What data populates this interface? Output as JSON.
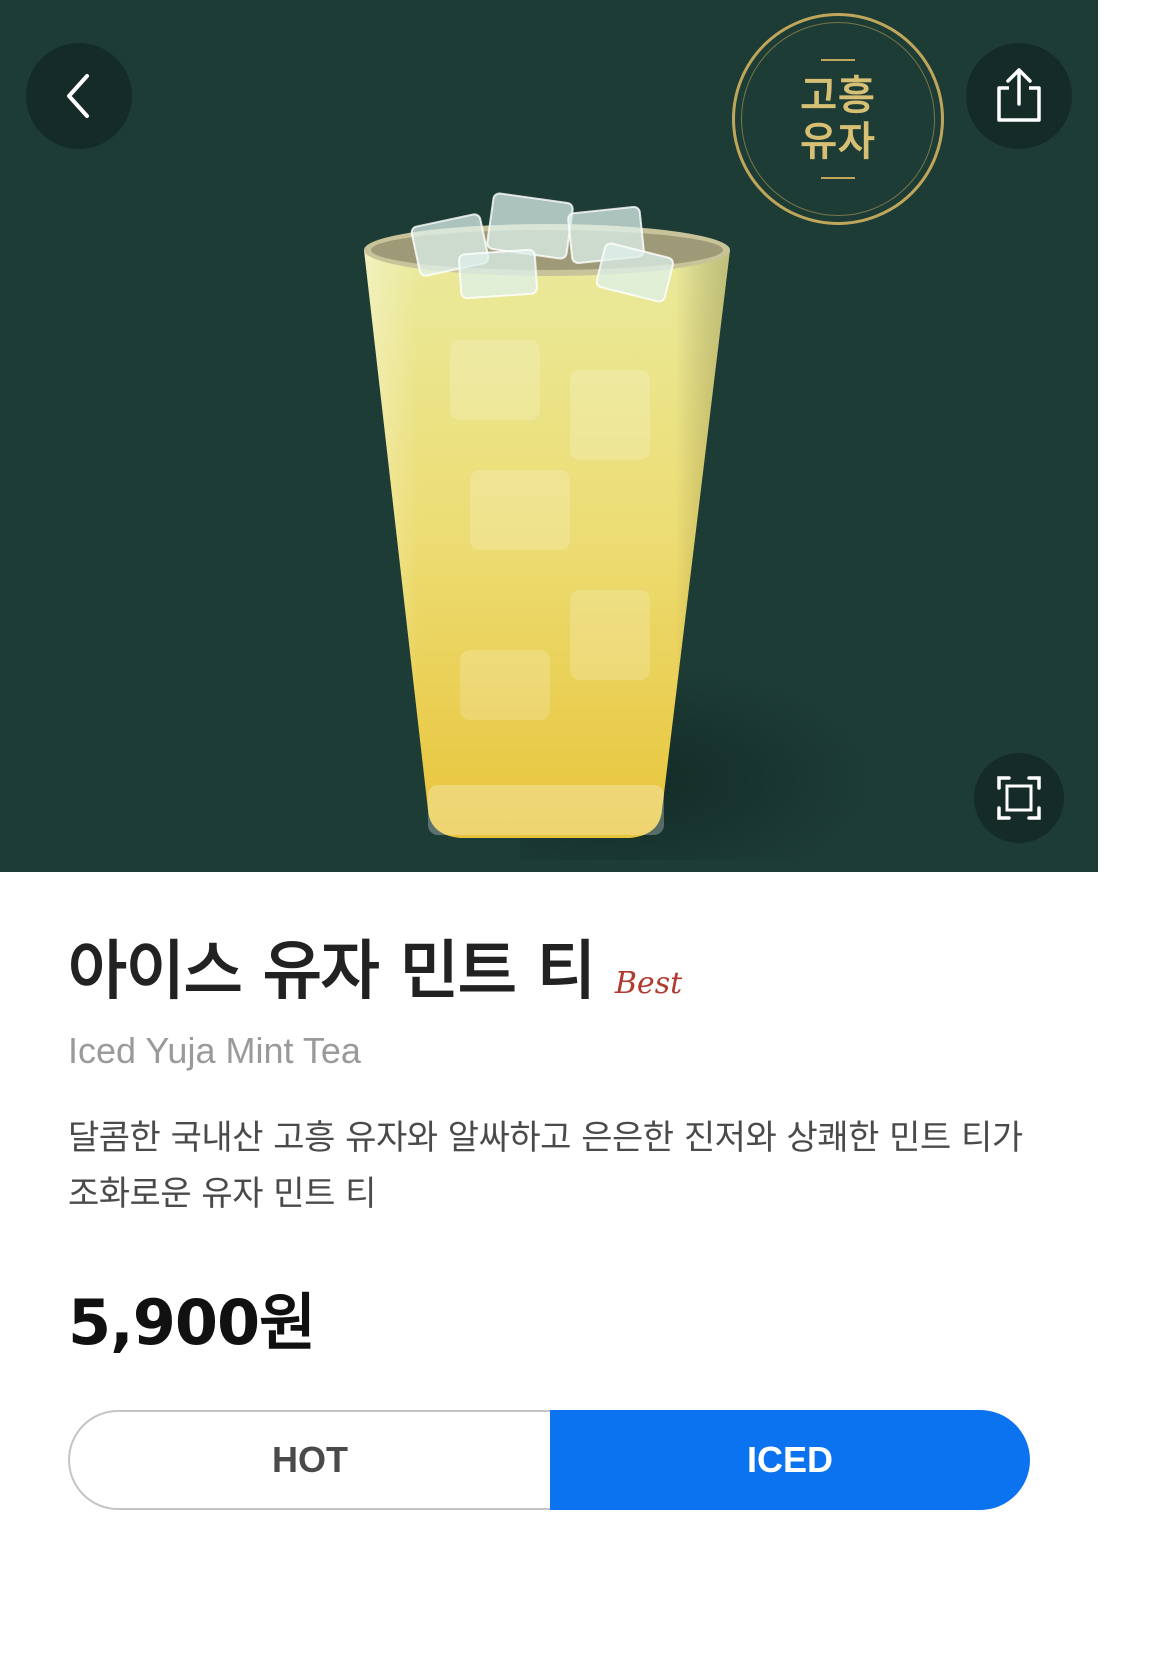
{
  "product": {
    "badge": "고흥\n유자",
    "badge_color": "#bfa65a",
    "title": "아이스 유자 민트 티",
    "best_label": "Best",
    "english_name": "Iced Yuja Mint Tea",
    "description": "달콤한 국내산 고흥 유자와 알싸하고 은은한 진저와 상쾌한 민트 티가 조화로운 유자 민트 티",
    "price": "5,900원"
  },
  "icons": {
    "back": "chevron-left-icon",
    "share": "share-icon",
    "zoom": "expand-icon"
  },
  "temperature": {
    "options": [
      "HOT",
      "ICED"
    ],
    "selected": "ICED",
    "accent_color": "#0b72f0"
  },
  "colors": {
    "hero_background": "#1e3c36"
  }
}
